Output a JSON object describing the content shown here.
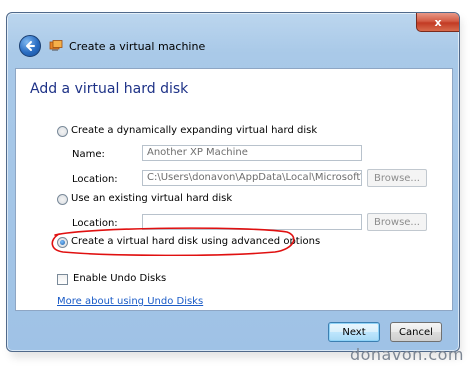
{
  "window": {
    "title": "Create a virtual machine",
    "close_glyph": "x"
  },
  "page": {
    "heading": "Add a virtual hard disk"
  },
  "option_dynamic": {
    "label": "Create a dynamically expanding virtual hard disk",
    "selected": false,
    "name_label": "Name:",
    "name_value": "Another XP Machine",
    "location_label": "Location:",
    "location_value": "C:\\Users\\donavon\\AppData\\Local\\Microsoft\\Windo",
    "browse_label": "Browse..."
  },
  "option_existing": {
    "label": "Use an existing virtual hard disk",
    "selected": false,
    "location_label": "Location:",
    "location_value": "",
    "browse_label": "Browse..."
  },
  "option_advanced": {
    "label": "Create a virtual hard disk using advanced options",
    "selected": true
  },
  "undo": {
    "label": "Enable Undo Disks",
    "checked": false
  },
  "link": {
    "text": "More about using Undo Disks"
  },
  "buttons": {
    "next": "Next",
    "cancel": "Cancel"
  },
  "watermark": "donavon.com",
  "colors": {
    "heading": "#1e3287",
    "link": "#1a5bc7",
    "annotation": "#e01010"
  }
}
